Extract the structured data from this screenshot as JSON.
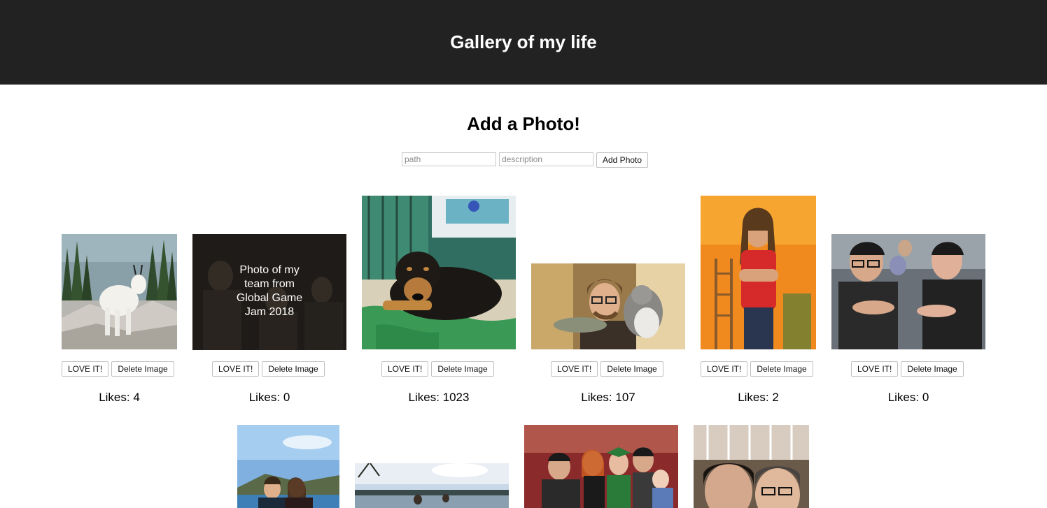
{
  "header": {
    "title": "Gallery of my life"
  },
  "form": {
    "title": "Add a Photo!",
    "path_placeholder": "path",
    "description_placeholder": "description",
    "submit_label": "Add Photo"
  },
  "photos": [
    {
      "name": "mountain-goat",
      "love_label": "LOVE IT!",
      "delete_label": "Delete Image",
      "likes": "Likes: 4"
    },
    {
      "name": "team-photo",
      "love_label": "LOVE IT!",
      "delete_label": "Delete Image",
      "likes": "Likes: 0",
      "caption": "Photo of my team from Global Game Jam 2018"
    },
    {
      "name": "dog",
      "love_label": "LOVE IT!",
      "delete_label": "Delete Image",
      "likes": "Likes: 1023"
    },
    {
      "name": "fish-and-cat",
      "love_label": "LOVE IT!",
      "delete_label": "Delete Image",
      "likes": "Likes: 107"
    },
    {
      "name": "man-red-shirt",
      "love_label": "LOVE IT!",
      "delete_label": "Delete Image",
      "likes": "Likes: 2"
    },
    {
      "name": "two-men-hats",
      "love_label": "LOVE IT!",
      "delete_label": "Delete Image",
      "likes": "Likes: 0"
    }
  ],
  "colors": {
    "header_bg": "#222222",
    "header_text": "#ffffff"
  }
}
